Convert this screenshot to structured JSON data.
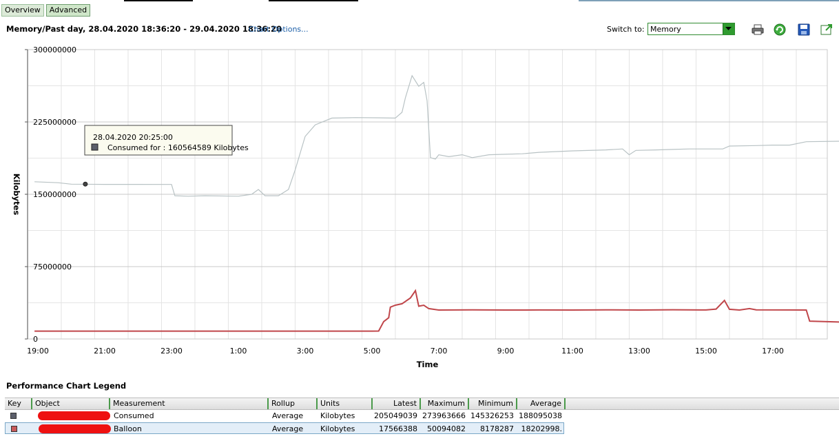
{
  "tabs": [
    {
      "label": "Overview"
    },
    {
      "label": "Advanced"
    }
  ],
  "header": {
    "title": "Memory/Past day, 28.04.2020 18:36:20 - 29.04.2020 18:36:20",
    "chart_options_label": "Chart Options...",
    "switch_label": "Switch to:",
    "switch_value": "Memory",
    "icons": [
      "printer-icon",
      "refresh-icon",
      "save-icon",
      "export-icon"
    ]
  },
  "tooltip": {
    "time": "28.04.2020 20:25:00",
    "text": "Consumed for : 160564589 Kilobytes"
  },
  "chart_data": {
    "type": "line",
    "xlabel": "Time",
    "ylabel": "Kilobytes",
    "ylim": [
      0,
      300000000
    ],
    "yticks": [
      "0",
      "75000000",
      "150000000",
      "225000000",
      "300000000"
    ],
    "xticks": [
      "19:00",
      "21:00",
      "23:00",
      "1:00",
      "3:00",
      "5:00",
      "7:00",
      "9:00",
      "11:00",
      "13:00",
      "15:00",
      "17:00"
    ],
    "grid": true,
    "series": [
      {
        "name": "Consumed",
        "color": "#b8c2c4",
        "points": [
          [
            -0.1,
            163000000
          ],
          [
            0.6,
            162000000
          ],
          [
            1,
            160500000
          ],
          [
            2,
            160300000
          ],
          [
            3,
            160300000
          ],
          [
            4,
            160200000
          ],
          [
            4.1,
            148500000
          ],
          [
            4.5,
            148000000
          ],
          [
            5,
            148500000
          ],
          [
            6,
            148000000
          ],
          [
            6.4,
            150000000
          ],
          [
            6.6,
            155000000
          ],
          [
            6.8,
            148500000
          ],
          [
            7.2,
            148500000
          ],
          [
            7.5,
            155000000
          ],
          [
            7.7,
            175000000
          ],
          [
            8.0,
            210000000
          ],
          [
            8.3,
            222000000
          ],
          [
            8.8,
            229000000
          ],
          [
            9.5,
            229500000
          ],
          [
            10.2,
            229300000
          ],
          [
            10.7,
            229000000
          ],
          [
            10.9,
            235000000
          ],
          [
            11.0,
            250000000
          ],
          [
            11.2,
            273000000
          ],
          [
            11.4,
            262000000
          ],
          [
            11.55,
            266000000
          ],
          [
            11.65,
            247000000
          ],
          [
            11.75,
            188000000
          ],
          [
            11.9,
            186500000
          ],
          [
            12.0,
            191000000
          ],
          [
            12.3,
            189000000
          ],
          [
            12.7,
            191000000
          ],
          [
            13.0,
            188000000
          ],
          [
            13.5,
            191000000
          ],
          [
            14.0,
            191500000
          ],
          [
            14.5,
            192000000
          ],
          [
            15.0,
            193500000
          ],
          [
            16.0,
            195000000
          ],
          [
            17.0,
            196000000
          ],
          [
            17.5,
            197000000
          ],
          [
            17.7,
            191000000
          ],
          [
            17.9,
            195500000
          ],
          [
            18.5,
            196000000
          ],
          [
            19.0,
            196500000
          ],
          [
            19.5,
            197000000
          ],
          [
            20.5,
            197000000
          ],
          [
            20.7,
            200000000
          ],
          [
            21.5,
            200500000
          ],
          [
            22.0,
            201000000
          ],
          [
            22.5,
            201000000
          ],
          [
            23.0,
            204500000
          ],
          [
            24.0,
            205000000
          ],
          [
            25.0,
            207500000
          ],
          [
            25.5,
            207000000
          ],
          [
            26.0,
            206000000
          ],
          [
            27.0,
            205500000
          ],
          [
            27.3,
            205049039
          ]
        ]
      },
      {
        "name": "Balloon",
        "color": "#c0464a",
        "points": [
          [
            -0.1,
            8178287
          ],
          [
            2,
            8178287
          ],
          [
            4,
            8178287
          ],
          [
            6,
            8178287
          ],
          [
            8,
            8178287
          ],
          [
            10,
            8178287
          ],
          [
            10.2,
            8200000
          ],
          [
            10.35,
            18000000
          ],
          [
            10.5,
            22000000
          ],
          [
            10.55,
            33000000
          ],
          [
            10.7,
            35000000
          ],
          [
            10.9,
            36500000
          ],
          [
            11.15,
            42500000
          ],
          [
            11.3,
            50094082
          ],
          [
            11.4,
            34000000
          ],
          [
            11.55,
            35000000
          ],
          [
            11.7,
            31500000
          ],
          [
            12,
            30000000
          ],
          [
            13,
            30200000
          ],
          [
            14,
            30000000
          ],
          [
            15,
            30100000
          ],
          [
            16,
            30000000
          ],
          [
            17,
            30200000
          ],
          [
            18,
            30000000
          ],
          [
            19,
            30300000
          ],
          [
            20,
            30100000
          ],
          [
            20.3,
            31000000
          ],
          [
            20.55,
            40000000
          ],
          [
            20.7,
            30800000
          ],
          [
            21.0,
            30000000
          ],
          [
            21.3,
            31500000
          ],
          [
            21.5,
            30200000
          ],
          [
            22.5,
            30100000
          ],
          [
            23.0,
            30000000
          ],
          [
            23.1,
            18500000
          ],
          [
            24.0,
            17600000
          ],
          [
            26.0,
            17566388
          ],
          [
            27.3,
            17566388
          ]
        ]
      }
    ]
  },
  "legend": {
    "title": "Performance Chart Legend",
    "headers": [
      "Key",
      "Object",
      "Measurement",
      "Rollup",
      "Units",
      "Latest",
      "Maximum",
      "Minimum",
      "Average"
    ],
    "rows": [
      {
        "key_color": "#5c5f6b",
        "measurement": "Consumed",
        "rollup": "Average",
        "units": "Kilobytes",
        "latest": "205049039",
        "maximum": "273963666",
        "minimum": "145326253",
        "average": "188095038"
      },
      {
        "key_color": "#c85a5a",
        "measurement": "Balloon",
        "rollup": "Average",
        "units": "Kilobytes",
        "latest": "17566388",
        "maximum": "50094082",
        "minimum": "8178287",
        "average": "18202998."
      }
    ]
  }
}
